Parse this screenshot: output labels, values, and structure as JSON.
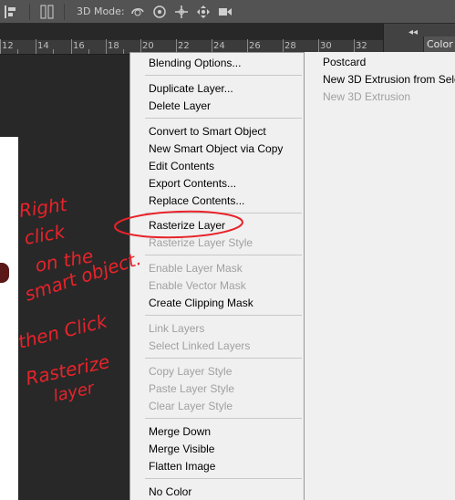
{
  "toolbar": {
    "mode_label": "3D Mode:",
    "icons": [
      "align-icon",
      "distribute-icon",
      "rotate-3d-icon",
      "roll-3d-icon",
      "pan-3d-icon",
      "slide-3d-icon",
      "scale-3d-icon"
    ]
  },
  "ruler": {
    "numbers": [
      "12",
      "14",
      "16",
      "18",
      "20",
      "22",
      "24",
      "26",
      "28",
      "30",
      "32"
    ]
  },
  "panel": {
    "collapse": "◂◂",
    "color_tab": "Color"
  },
  "menu": {
    "blending_options": "Blending Options...",
    "duplicate_layer": "Duplicate Layer...",
    "delete_layer": "Delete Layer",
    "convert_to_smart_object": "Convert to Smart Object",
    "new_smart_object_via_copy": "New Smart Object via Copy",
    "edit_contents": "Edit Contents",
    "export_contents": "Export Contents...",
    "replace_contents": "Replace Contents...",
    "rasterize_layer": "Rasterize Layer",
    "rasterize_layer_style": "Rasterize Layer Style",
    "enable_layer_mask": "Enable Layer Mask",
    "enable_vector_mask": "Enable Vector Mask",
    "create_clipping_mask": "Create Clipping Mask",
    "link_layers": "Link Layers",
    "select_linked_layers": "Select Linked Layers",
    "copy_layer_style": "Copy Layer Style",
    "paste_layer_style": "Paste Layer Style",
    "clear_layer_style": "Clear Layer Style",
    "merge_down": "Merge Down",
    "merge_visible": "Merge Visible",
    "flatten_image": "Flatten Image",
    "no_color": "No Color"
  },
  "submenu": {
    "postcard": "Postcard",
    "new_3d_extrusion_from_selection": "New 3D Extrusion from Sele",
    "new_3d_extrusion": "New 3D Extrusion"
  },
  "annotation": {
    "lines": [
      "Right",
      "click",
      "on the",
      "smart object.",
      "then Click",
      "Rasterize",
      "layer"
    ],
    "color": "#e8232a"
  }
}
